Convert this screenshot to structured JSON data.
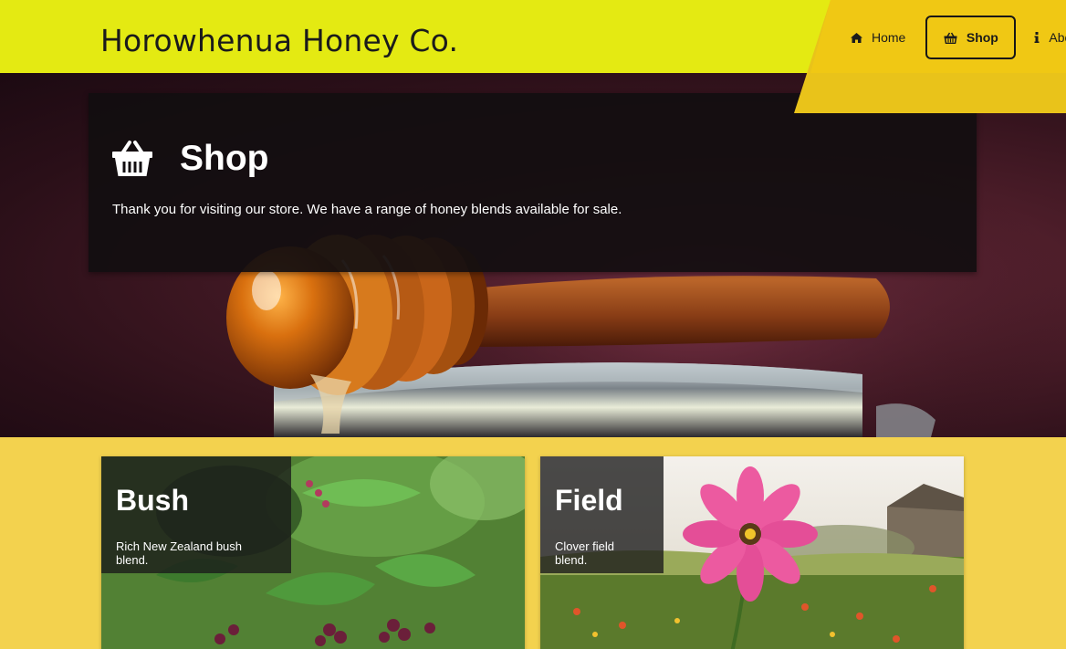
{
  "header": {
    "brand": "Horowhenua Honey Co.",
    "accent_color": "#e4ea12",
    "nav_accent_color": "#f0c814"
  },
  "nav": {
    "items": [
      {
        "label": "Home",
        "icon": "home-icon"
      },
      {
        "label": "Shop",
        "icon": "basket-icon",
        "active": true
      },
      {
        "label": "Abou",
        "icon": "info-icon"
      }
    ]
  },
  "shop_intro": {
    "icon": "basket-icon",
    "title": "Shop",
    "text": "Thank you for visiting our store. We have a range of honey blends available for sale."
  },
  "products": [
    {
      "title": "Bush",
      "description": "Rich New Zealand bush blend."
    },
    {
      "title": "Field",
      "description": "Clover field blend."
    }
  ],
  "page_background": "#f3d24e"
}
